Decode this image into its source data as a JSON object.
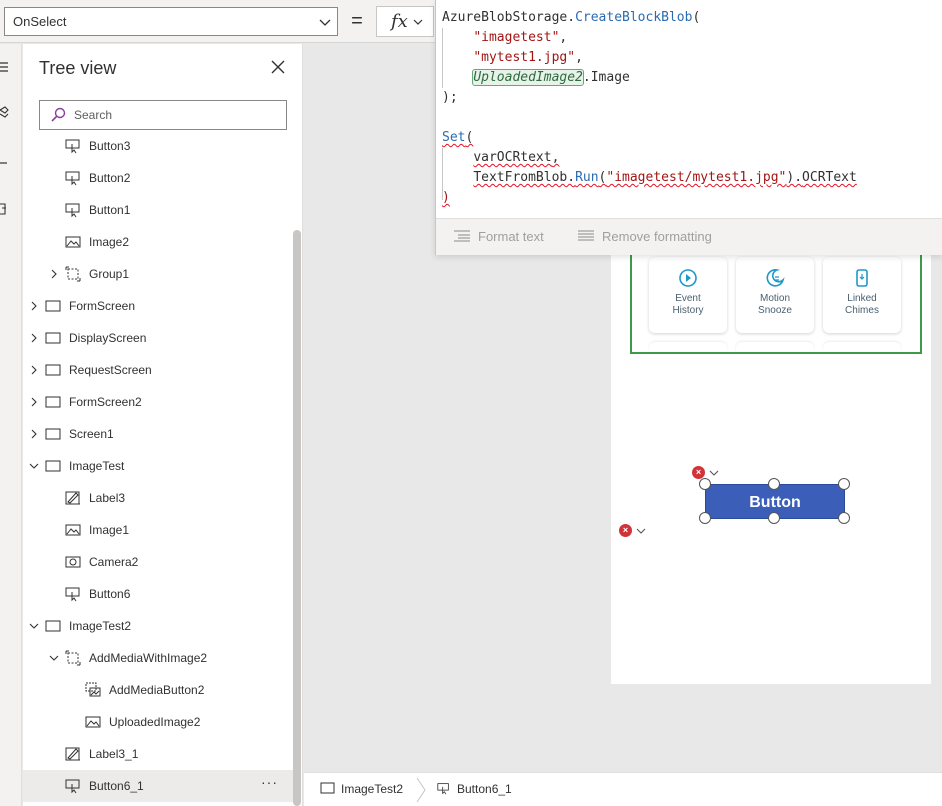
{
  "formula_bar": {
    "property": "OnSelect",
    "equals": "=",
    "fx": "fx"
  },
  "tree": {
    "title": "Tree view",
    "search_placeholder": "Search",
    "items": [
      {
        "label": "Button3",
        "icon": "button-icon"
      },
      {
        "label": "Button2",
        "icon": "button-icon"
      },
      {
        "label": "Button1",
        "icon": "button-icon"
      },
      {
        "label": "Image2",
        "icon": "image-icon"
      },
      {
        "label": "Group1",
        "icon": "group-icon"
      },
      {
        "label": "FormScreen",
        "icon": "screen-icon"
      },
      {
        "label": "DisplayScreen",
        "icon": "screen-icon"
      },
      {
        "label": "RequestScreen",
        "icon": "screen-icon"
      },
      {
        "label": "FormScreen2",
        "icon": "screen-icon"
      },
      {
        "label": "Screen1",
        "icon": "screen-icon"
      },
      {
        "label": "ImageTest",
        "icon": "screen-icon"
      },
      {
        "label": "Label3",
        "icon": "label-icon"
      },
      {
        "label": "Image1",
        "icon": "image-icon"
      },
      {
        "label": "Camera2",
        "icon": "camera-icon"
      },
      {
        "label": "Button6",
        "icon": "button-icon"
      },
      {
        "label": "ImageTest2",
        "icon": "screen-icon"
      },
      {
        "label": "AddMediaWithImage2",
        "icon": "group-icon"
      },
      {
        "label": "AddMediaButton2",
        "icon": "add-media-icon"
      },
      {
        "label": "UploadedImage2",
        "icon": "image-icon"
      },
      {
        "label": "Label3_1",
        "icon": "label-icon"
      },
      {
        "label": "Button6_1",
        "icon": "button-icon",
        "selected": true
      }
    ],
    "more_label": "···"
  },
  "editor": {
    "line1_ns": "AzureBlobStorage.",
    "line1_fn": "CreateBlockBlob",
    "line1_open": "(",
    "line2": "\"imagetest\"",
    "line2_comma": ",",
    "line3": "\"mytest1.jpg\"",
    "line3_comma": ",",
    "line4_ctrl": "UploadedImage2",
    "line4_prop": ".Image",
    "line5": ");",
    "line7_fn": "Set",
    "line7_open": "(",
    "line8_var": "varOCRtext",
    "line8_comma": ",",
    "line9_fn": "TextFromBlob.",
    "line9_run": "Run",
    "line9_open": "(",
    "line9_str": "\"imagetest/mytest1.jpg\"",
    "line9_close": ").",
    "line9_prop": "OCRText",
    "line10": ")",
    "format_text": "Format text",
    "remove_formatting": "Remove formatting"
  },
  "canvas": {
    "tiles": [
      {
        "label": "Event\nHistory",
        "icon": "history-icon"
      },
      {
        "label": "Motion\nSnooze",
        "icon": "snooze-icon"
      },
      {
        "label": "Linked\nChimes",
        "icon": "chime-icon"
      }
    ],
    "button_label": "Button",
    "error_badge": "×"
  },
  "breadcrumb": {
    "screen": "ImageTest2",
    "control": "Button6_1"
  },
  "colors": {
    "accent": "#3b5fb8",
    "gallery_border": "#3e9b48",
    "error": "#d13438",
    "function": "#2b6cb0",
    "string": "#a31515"
  }
}
